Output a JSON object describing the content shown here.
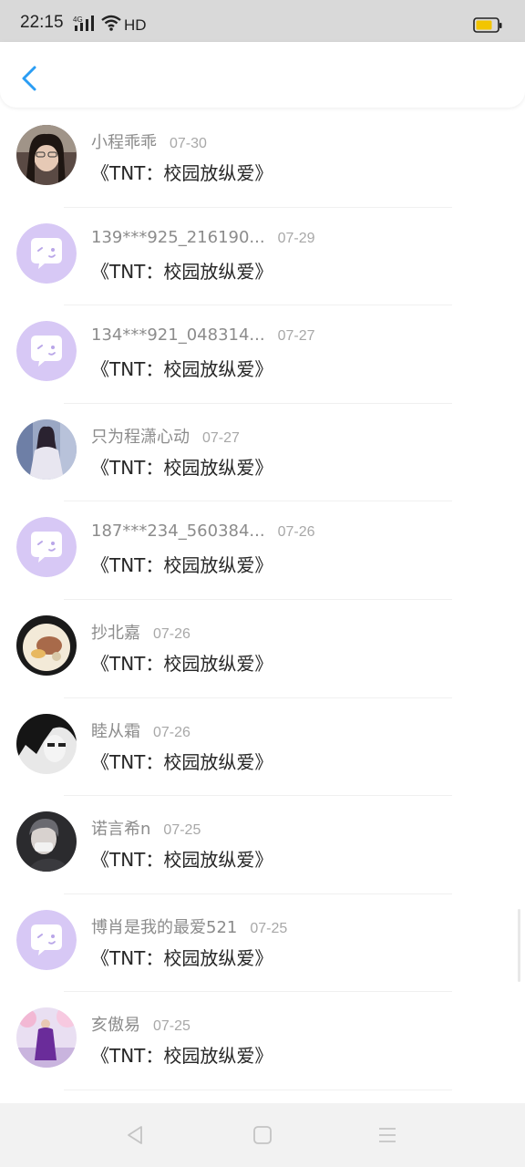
{
  "status_bar": {
    "time": "22:15",
    "network_type": "4G",
    "hd_label": "HD",
    "battery_color": "#f2c500"
  },
  "header": {
    "back_icon": "chevron-left-icon",
    "accent_color": "#2a9df4"
  },
  "items": [
    {
      "name": "小程乖乖",
      "date": "07-30",
      "title": "《TNT：校园放纵爱》",
      "avatar": "photo-girl-dark-hair"
    },
    {
      "name": "139***925_216190...",
      "date": "07-29",
      "title": "《TNT：校园放纵爱》",
      "avatar": "default-chat-bubble-icon"
    },
    {
      "name": "134***921_048314...",
      "date": "07-27",
      "title": "《TNT：校园放纵爱》",
      "avatar": "default-chat-bubble-icon"
    },
    {
      "name": "只为程潇心动",
      "date": "07-27",
      "title": "《TNT：校园放纵爱》",
      "avatar": "photo-girl-white-dress"
    },
    {
      "name": "187***234_560384...",
      "date": "07-26",
      "title": "《TNT：校园放纵爱》",
      "avatar": "default-chat-bubble-icon"
    },
    {
      "name": "抄北嘉",
      "date": "07-26",
      "title": "《TNT：校园放纵爱》",
      "avatar": "photo-food-bowl"
    },
    {
      "name": "睦从霜",
      "date": "07-26",
      "title": "《TNT：校园放纵爱》",
      "avatar": "photo-anime-boy-mono"
    },
    {
      "name": "诺言希n",
      "date": "07-25",
      "title": "《TNT：校园放纵爱》",
      "avatar": "photo-boy-mask"
    },
    {
      "name": "博肖是我的最爱521",
      "date": "07-25",
      "title": "《TNT：校园放纵爱》",
      "avatar": "default-chat-bubble-icon"
    },
    {
      "name": "亥傲易",
      "date": "07-25",
      "title": "《TNT：校园放纵爱》",
      "avatar": "photo-woman-purple-dress"
    }
  ],
  "nav_bar": {
    "back": "triangle-back-icon",
    "home": "square-home-icon",
    "menu": "three-lines-menu-icon"
  },
  "colors": {
    "default_avatar_bg": "#d7c8f5",
    "name_text": "#8c8c8c",
    "date_text": "#a8a8a8",
    "title_text": "#262626"
  }
}
